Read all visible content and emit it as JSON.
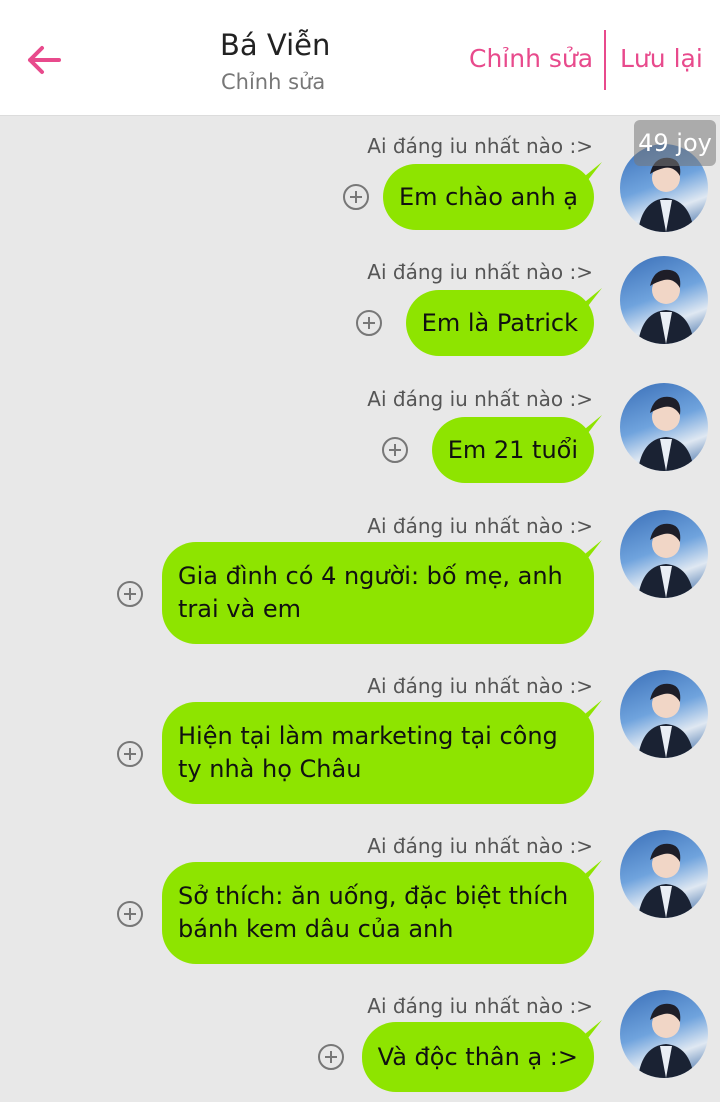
{
  "header": {
    "title": "Bá Viễn",
    "subtitle": "Chỉnh sửa",
    "edit_label": "Chỉnh sửa",
    "save_label": "Lưu lại"
  },
  "badge": "49 joy",
  "colors": {
    "accent": "#e84a8c",
    "bubble": "#8ee400",
    "background": "#e8e8e8"
  },
  "messages": [
    {
      "sender": "Ai đáng iu nhất nào :>",
      "text": "Em chào anh ạ"
    },
    {
      "sender": "Ai đáng iu nhất nào :>",
      "text": "Em là Patrick"
    },
    {
      "sender": "Ai đáng iu nhất nào :>",
      "text": "Em 21 tuổi"
    },
    {
      "sender": "Ai đáng iu nhất nào :>",
      "text": "Gia đình có 4 người: bố mẹ, anh trai và em"
    },
    {
      "sender": "Ai đáng iu nhất nào :>",
      "text": "Hiện tại làm marketing tại công ty nhà họ Châu"
    },
    {
      "sender": "Ai đáng iu nhất nào :>",
      "text": "Sở thích: ăn uống, đặc biệt thích bánh kem dâu của anh"
    },
    {
      "sender": "Ai đáng iu nhất nào :>",
      "text": "Và độc thân ạ :>"
    }
  ]
}
